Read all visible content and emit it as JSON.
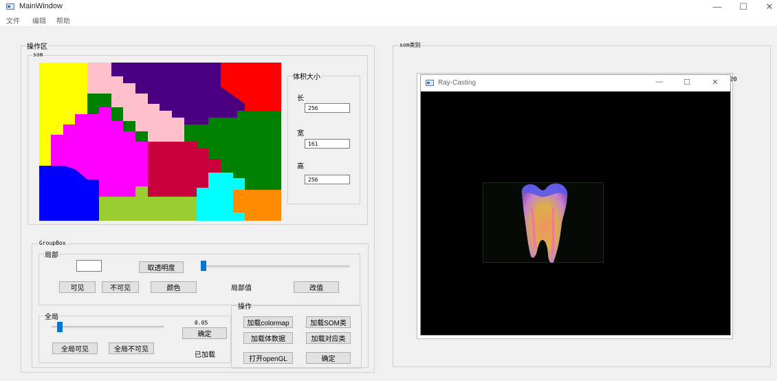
{
  "window": {
    "title": "MainWindow",
    "controls": {
      "minimize": "—",
      "maximize": "☐",
      "close": "✕"
    }
  },
  "menu": {
    "items": [
      "文件",
      "编辑",
      "帮助"
    ]
  },
  "left_panel": {
    "title": "操作区",
    "som": {
      "label": "som",
      "cluster_colors": [
        "#ffff00",
        "#ffc0cb",
        "#4b0082",
        "#ff0000",
        "#ff00ff",
        "#008000",
        "#c8003c",
        "#0000ff",
        "#9acd32",
        "#00ffff",
        "#ff8c00"
      ]
    },
    "volume": {
      "title": "体积大小",
      "length_label": "长",
      "length_value": "256",
      "width_label": "宽",
      "width_value": "161",
      "height_label": "高",
      "height_value": "256"
    },
    "groupbox": {
      "title": "GroupBox",
      "local": {
        "title": "局部",
        "color_input": "",
        "opacity_button": "取透明度",
        "opacity_slider": 0.0,
        "visible_button": "可见",
        "invisible_button": "不可见",
        "color_button": "颜色",
        "local_value_label": "局部值",
        "change_value_button": "改值"
      },
      "global": {
        "title": "全局",
        "slider_value": 0.05,
        "value_text": "0.05",
        "confirm_button": "确定",
        "all_visible_button": "全局可见",
        "all_invisible_button": "全局不可见",
        "status": "已加载"
      },
      "ops": {
        "title": "操作",
        "load_colormap": "加载colormap",
        "load_som_class": "加载SOM类",
        "load_volume": "加载体数据",
        "load_class_map": "加载对应类",
        "open_opengl": "打开openGL",
        "confirm": "确定"
      }
    }
  },
  "right_panel": {
    "title": "som类别",
    "raycast": {
      "title": "Ray-Casting",
      "controls": {
        "minimize": "—",
        "maximize": "☐",
        "close": "✕"
      },
      "behind_number": "20"
    }
  }
}
